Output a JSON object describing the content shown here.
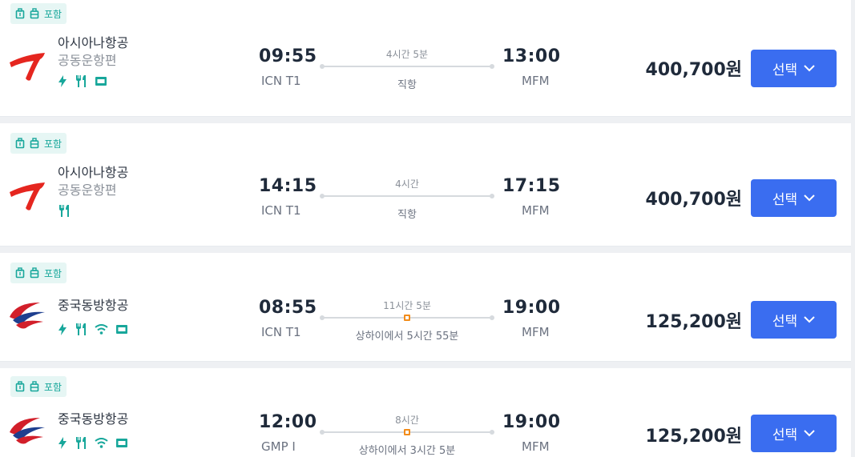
{
  "flights": [
    {
      "baggage_label": "포함",
      "airline": "아시아나항공",
      "codeshare": "공동운항편",
      "amenities": [
        "power-icon",
        "meal-icon",
        "entertainment-icon"
      ],
      "dep_time": "09:55",
      "dep_airport": "ICN T1",
      "duration": "4시간 5분",
      "stops": "직항",
      "arr_time": "13:00",
      "arr_airport": "MFM",
      "price": "400,700원",
      "select_label": "선택"
    },
    {
      "baggage_label": "포함",
      "airline": "아시아나항공",
      "codeshare": "공동운항편",
      "amenities": [
        "meal-icon"
      ],
      "dep_time": "14:15",
      "dep_airport": "ICN T1",
      "duration": "4시간",
      "stops": "직항",
      "arr_time": "17:15",
      "arr_airport": "MFM",
      "price": "400,700원",
      "select_label": "선택"
    },
    {
      "baggage_label": "포함",
      "airline": "중국동방항공",
      "codeshare": "",
      "amenities": [
        "power-icon",
        "meal-icon",
        "wifi-icon",
        "entertainment-icon"
      ],
      "dep_time": "08:55",
      "dep_airport": "ICN T1",
      "duration": "11시간 5분",
      "stops": "상하이에서 5시간 55분",
      "arr_time": "19:00",
      "arr_airport": "MFM",
      "price": "125,200원",
      "select_label": "선택"
    },
    {
      "baggage_label": "포함",
      "airline": "중국동방항공",
      "codeshare": "",
      "amenities": [
        "power-icon",
        "meal-icon",
        "wifi-icon",
        "entertainment-icon"
      ],
      "dep_time": "12:00",
      "dep_airport": "GMP I",
      "duration": "8시간",
      "stops": "상하이에서 3시간 5분",
      "arr_time": "19:00",
      "arr_airport": "MFM",
      "price": "125,200원",
      "select_label": "선택"
    }
  ],
  "colors": {
    "accent": "#3a6df0",
    "amenity": "#18a79b",
    "stopover": "#f28c1b",
    "asiana": "#e5261f",
    "china_eastern_red": "#d21f2a",
    "china_eastern_blue": "#1e3f8f"
  }
}
